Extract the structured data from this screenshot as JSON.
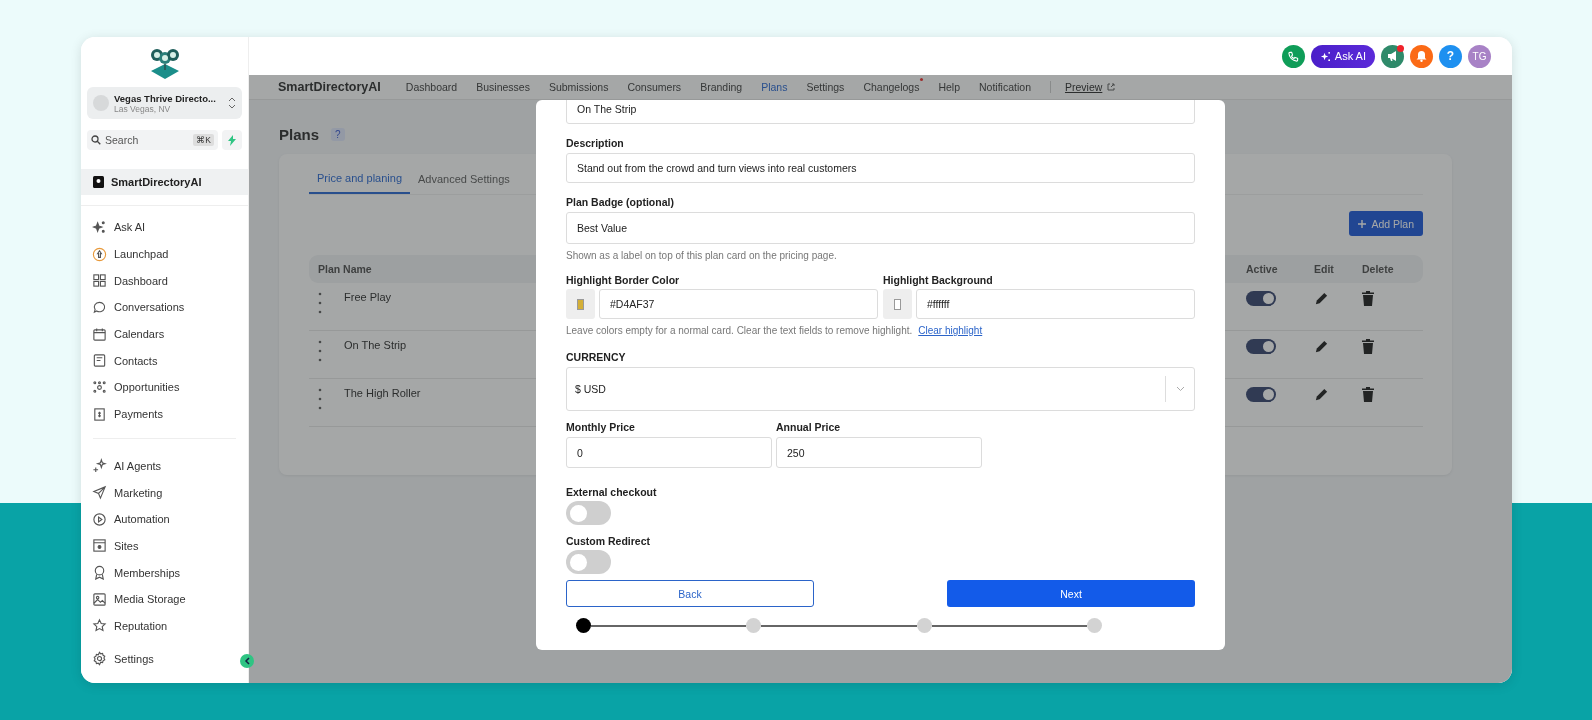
{
  "sidebar": {
    "account": {
      "name": "Vegas Thrive Directo...",
      "location": "Las Vegas, NV"
    },
    "search": {
      "placeholder": "Search",
      "shortcut": "⌘K"
    },
    "pinned": {
      "label": "SmartDirectoryAI",
      "selected": true
    },
    "groups": [
      [
        {
          "label": "Ask AI",
          "selected": false
        },
        {
          "label": "Launchpad",
          "selected": false
        },
        {
          "label": "Dashboard",
          "selected": false
        },
        {
          "label": "Conversations",
          "selected": false
        },
        {
          "label": "Calendars",
          "selected": false
        },
        {
          "label": "Contacts",
          "selected": false
        },
        {
          "label": "Opportunities",
          "selected": false
        },
        {
          "label": "Payments",
          "selected": false
        }
      ],
      [
        {
          "label": "AI Agents",
          "selected": false
        },
        {
          "label": "Marketing",
          "selected": false
        },
        {
          "label": "Automation",
          "selected": false
        },
        {
          "label": "Sites",
          "selected": false
        },
        {
          "label": "Memberships",
          "selected": false
        },
        {
          "label": "Media Storage",
          "selected": false
        },
        {
          "label": "Reputation",
          "selected": false
        }
      ]
    ],
    "settings": "Settings"
  },
  "header": {
    "ask_ai": "Ask AI",
    "notification_dot": true,
    "help": "?",
    "avatar": "TG"
  },
  "subnav": {
    "brand": "SmartDirectoryAI",
    "items": [
      {
        "label": "Dashboard",
        "selected": false,
        "dot": false
      },
      {
        "label": "Businesses",
        "selected": false,
        "dot": false
      },
      {
        "label": "Submissions",
        "selected": false,
        "dot": false
      },
      {
        "label": "Consumers",
        "selected": false,
        "dot": false
      },
      {
        "label": "Branding",
        "selected": false,
        "dot": false
      },
      {
        "label": "Plans",
        "selected": true,
        "dot": false
      },
      {
        "label": "Settings",
        "selected": false,
        "dot": false
      },
      {
        "label": "Changelogs",
        "selected": false,
        "dot": true
      },
      {
        "label": "Help",
        "selected": false,
        "dot": false
      },
      {
        "label": "Notification",
        "selected": false,
        "dot": false
      }
    ],
    "preview": "Preview"
  },
  "page": {
    "title": "Plans",
    "help": "?",
    "tabs": [
      {
        "label": "Price and planing",
        "selected": true
      },
      {
        "label": "Advanced Settings",
        "selected": false
      }
    ],
    "add_button": "Add Plan",
    "table": {
      "columns": [
        "Plan Name",
        "Active",
        "Edit",
        "Delete"
      ],
      "rows": [
        {
          "name": "Free Play",
          "active": true
        },
        {
          "name": "On The Strip",
          "active": true
        },
        {
          "name": "The High Roller",
          "active": true
        }
      ]
    }
  },
  "modal": {
    "name_value": "On The Strip",
    "description": {
      "label": "Description",
      "value": "Stand out from the crowd and turn views into real customers"
    },
    "badge": {
      "label": "Plan Badge (optional)",
      "value": "Best Value",
      "hint": "Shown as a label on top of this plan card on the pricing page."
    },
    "colors": [
      {
        "label": "Highlight Border Color",
        "value": "#D4AF37",
        "color": "#d4af37"
      },
      {
        "label": "Highlight Background",
        "value": "#ffffff",
        "color": "#ffffff"
      }
    ],
    "colors_hint": "Leave colors empty for a normal card. Clear the text fields to remove highlight.",
    "clear_link": "Clear highlight",
    "currency": {
      "label": "CURRENCY",
      "value": "$ USD"
    },
    "prices": [
      {
        "label": "Monthly Price",
        "value": "0"
      },
      {
        "label": "Annual Price",
        "value": "250"
      }
    ],
    "toggles": [
      {
        "label": "External checkout",
        "on": false
      },
      {
        "label": "Custom Redirect",
        "on": false
      }
    ],
    "back": "Back",
    "next": "Next",
    "steps": [
      {
        "selected": true
      },
      {
        "selected": false
      },
      {
        "selected": false
      },
      {
        "selected": false
      }
    ]
  }
}
